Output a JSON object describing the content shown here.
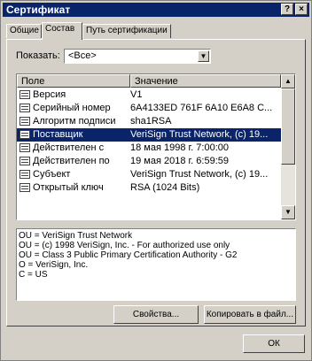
{
  "window": {
    "title": "Сертификат",
    "help": "?",
    "close": "×"
  },
  "tabs": [
    {
      "label": "Общие"
    },
    {
      "label": "Состав"
    },
    {
      "label": "Путь сертификации"
    }
  ],
  "show": {
    "label": "Показать:",
    "value": "<Все>"
  },
  "list": {
    "columns": [
      "Поле",
      "Значение"
    ],
    "rows": [
      {
        "field": "Версия",
        "value": "V1"
      },
      {
        "field": "Серийный номер",
        "value": "6A4133ED 761F 6A10 E6A8 C..."
      },
      {
        "field": "Алгоритм подписи",
        "value": "sha1RSA"
      },
      {
        "field": "Поставщик",
        "value": "VeriSign Trust Network, (c) 19..."
      },
      {
        "field": "Действителен с",
        "value": "18 мая 1998 г. 7:00:00"
      },
      {
        "field": "Действителен по",
        "value": "19 мая 2018 г. 6:59:59"
      },
      {
        "field": "Субъект",
        "value": "VeriSign Trust Network, (c) 19..."
      },
      {
        "field": "Открытый ключ",
        "value": "RSA (1024 Bits)"
      }
    ]
  },
  "detail": {
    "lines": [
      "OU = VeriSign Trust Network",
      "OU = (c) 1998 VeriSign, Inc. - For authorized use only",
      "OU = Class 3 Public Primary Certification Authority - G2",
      "O = VeriSign, Inc.",
      "C = US"
    ]
  },
  "buttons": {
    "properties": "Свойства...",
    "copy": "Копировать в файл...",
    "ok": "ОК"
  }
}
